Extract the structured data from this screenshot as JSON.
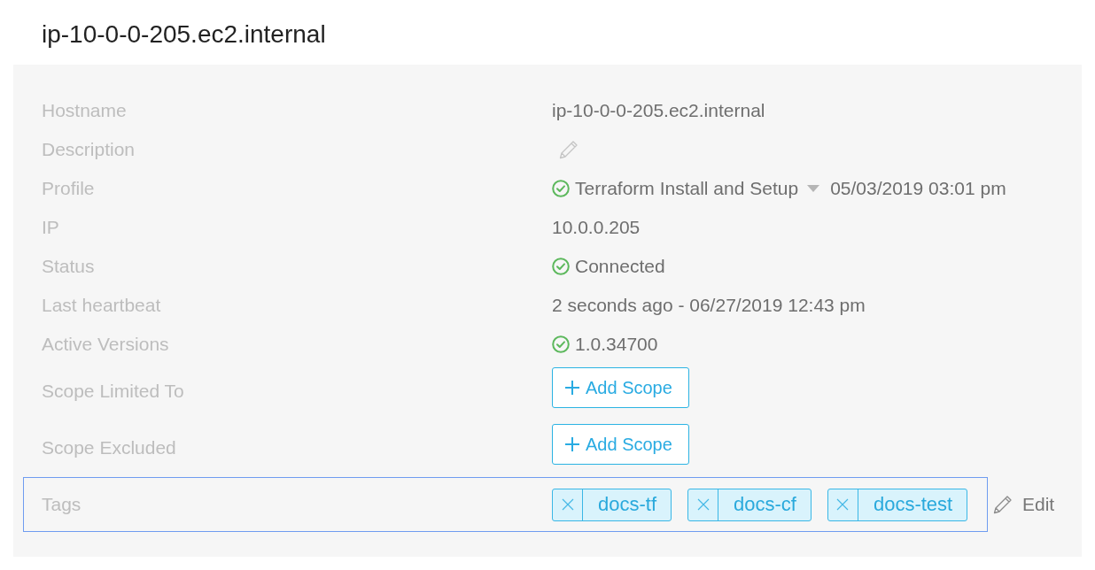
{
  "title": "ip-10-0-0-205.ec2.internal",
  "fields": [
    {
      "kind": "text",
      "label": "Hostname",
      "value": "ip-10-0-0-205.ec2.internal",
      "highlighted": false
    },
    {
      "kind": "edit",
      "label": "Description",
      "highlighted": false
    },
    {
      "kind": "profile",
      "label": "Profile",
      "ok": true,
      "value": "Terraform Install and Setup",
      "date": "05/03/2019 03:01 pm",
      "highlighted": false
    },
    {
      "kind": "text",
      "label": "IP",
      "value": "10.0.0.205",
      "highlighted": false
    },
    {
      "kind": "status",
      "label": "Status",
      "ok": true,
      "value": "Connected",
      "highlighted": false
    },
    {
      "kind": "text",
      "label": "Last heartbeat",
      "value": "2 seconds ago - 06/27/2019 12:43 pm",
      "highlighted": false
    },
    {
      "kind": "status",
      "label": "Active Versions",
      "ok": true,
      "value": "1.0.34700",
      "highlighted": false
    },
    {
      "kind": "scope",
      "label": "Scope Limited To",
      "button": "Add Scope",
      "highlighted": false
    },
    {
      "kind": "scope",
      "label": "Scope Excluded",
      "button": "Add Scope",
      "highlighted": false
    },
    {
      "kind": "tags",
      "label": "Tags",
      "tags": [
        "docs-tf",
        "docs-cf",
        "docs-test"
      ],
      "edit": "Edit",
      "highlighted": true
    }
  ]
}
